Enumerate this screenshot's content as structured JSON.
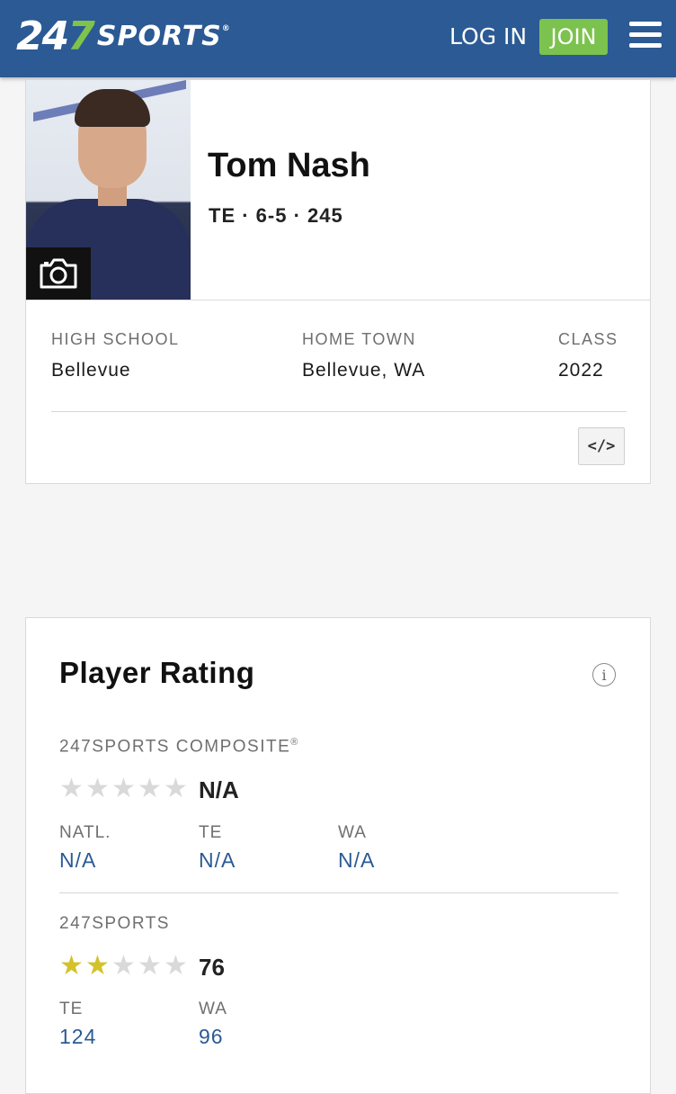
{
  "header": {
    "logo": {
      "digits_a": "24",
      "digits_b": "7",
      "word": "SPORTS",
      "reg": "®"
    },
    "login_label": "LOG IN",
    "join_label": "JOIN",
    "brand_color": "#2b5a94",
    "join_color": "#7cc24e"
  },
  "player": {
    "name": "Tom Nash",
    "meta": "TE · 6-5 · 245"
  },
  "details": {
    "high_school": {
      "label": "HIGH SCHOOL",
      "value": "Bellevue"
    },
    "home_town": {
      "label": "HOME TOWN",
      "value": "Bellevue, WA"
    },
    "class": {
      "label": "CLASS",
      "value": "2022"
    },
    "embed_label": "</>"
  },
  "rating": {
    "title": "Player Rating",
    "info_icon": "i",
    "composite": {
      "label": "247SPORTS COMPOSITE",
      "reg": "®",
      "stars_filled": 0,
      "stars_total": 5,
      "score": "N/A",
      "ranks": [
        {
          "label": "NATL.",
          "value": "N/A"
        },
        {
          "label": "TE",
          "value": "N/A"
        },
        {
          "label": "WA",
          "value": "N/A"
        }
      ]
    },
    "sports247": {
      "label": "247SPORTS",
      "stars_filled": 2,
      "stars_total": 5,
      "score": "76",
      "ranks": [
        {
          "label": "TE",
          "value": "124"
        },
        {
          "label": "WA",
          "value": "96"
        }
      ]
    },
    "star_on_color": "#d4c22b",
    "star_off_color": "#d9d9d9"
  }
}
